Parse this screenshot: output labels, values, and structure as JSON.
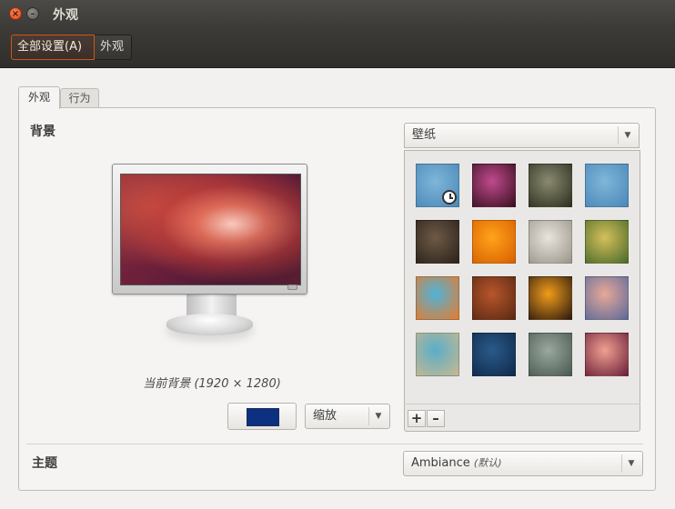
{
  "window": {
    "title": "外观",
    "close_symbol": "×",
    "minimize_symbol": "–"
  },
  "toolbar": {
    "all_settings_label": "全部设置(A)",
    "current_label": "外观"
  },
  "tabs": [
    {
      "label": "外观",
      "active": true
    },
    {
      "label": "行为",
      "active": false
    }
  ],
  "background": {
    "section_title": "背景",
    "monitor_caption": "当前背景 (1920 × 1280)",
    "color_swatch": "#0d3080",
    "scale_dropdown": "缩放",
    "source_dropdown": "壁纸",
    "wallpapers": [
      {
        "name": "wallpaper-birds-blue",
        "colors": [
          "#7fb6d9",
          "#4a88b8"
        ],
        "selected": true
      },
      {
        "name": "wallpaper-purple-flower",
        "colors": [
          "#c04a8e",
          "#3a1020"
        ],
        "selected": false
      },
      {
        "name": "wallpaper-white-blossoms",
        "colors": [
          "#8a8a70",
          "#2d3020"
        ],
        "selected": false
      },
      {
        "name": "wallpaper-birds-blue-2",
        "colors": [
          "#7fb6d9",
          "#4a88b8"
        ],
        "selected": false
      },
      {
        "name": "wallpaper-dark-ground",
        "colors": [
          "#6e5a46",
          "#2a221a"
        ],
        "selected": false
      },
      {
        "name": "wallpaper-orange-petals",
        "colors": [
          "#ffa31a",
          "#d95f00"
        ],
        "selected": false
      },
      {
        "name": "wallpaper-tin-toy",
        "colors": [
          "#e8e4dc",
          "#9a958a"
        ],
        "selected": false
      },
      {
        "name": "wallpaper-yellow-flower",
        "colors": [
          "#d4c05a",
          "#4a6a2a"
        ],
        "selected": false
      },
      {
        "name": "wallpaper-graffiti",
        "colors": [
          "#4fb3d9",
          "#e87a2a"
        ],
        "selected": false
      },
      {
        "name": "wallpaper-rust-shell",
        "colors": [
          "#b8552a",
          "#5a2a14"
        ],
        "selected": false
      },
      {
        "name": "wallpaper-orange-ring",
        "colors": [
          "#f29c1a",
          "#2a1a10"
        ],
        "selected": false
      },
      {
        "name": "wallpaper-sunset-city",
        "colors": [
          "#e8a898",
          "#5a6a9a"
        ],
        "selected": false
      },
      {
        "name": "wallpaper-rope",
        "colors": [
          "#5aaec8",
          "#c8b890"
        ],
        "selected": false
      },
      {
        "name": "wallpaper-blue-tiles",
        "colors": [
          "#2a5a8a",
          "#102a4a"
        ],
        "selected": false
      },
      {
        "name": "wallpaper-blurred-plant",
        "colors": [
          "#9aa8a0",
          "#4a5a50"
        ],
        "selected": false
      },
      {
        "name": "wallpaper-ubuntu-warty",
        "colors": [
          "#f0a090",
          "#6a1f3a"
        ],
        "selected": false
      }
    ],
    "add_symbol": "+",
    "remove_symbol": "–"
  },
  "theme": {
    "section_title": "主题",
    "value": "Ambiance",
    "default_tag": "(默认)"
  },
  "icons": {
    "dropdown_arrow": "▼"
  }
}
